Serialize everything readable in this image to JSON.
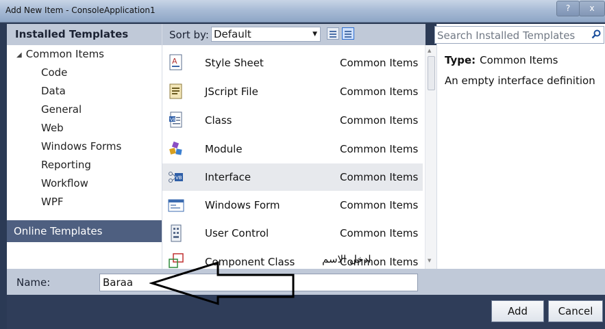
{
  "window": {
    "title": "Add New Item - ConsoleApplication1",
    "help": "?",
    "close": "x"
  },
  "left_panel": {
    "header": "Installed Templates",
    "root": "Common Items",
    "children": [
      "Code",
      "Data",
      "General",
      "Web",
      "Windows Forms",
      "Reporting",
      "Workflow",
      "WPF"
    ],
    "online": "Online Templates"
  },
  "toolbar": {
    "sort_label": "Sort by:",
    "sort_value": "Default"
  },
  "templates": [
    {
      "name": "Style Sheet",
      "category": "Common Items",
      "icon": "style-sheet-icon"
    },
    {
      "name": "JScript File",
      "category": "Common Items",
      "icon": "jscript-file-icon"
    },
    {
      "name": "Class",
      "category": "Common Items",
      "icon": "class-icon"
    },
    {
      "name": "Module",
      "category": "Common Items",
      "icon": "module-icon"
    },
    {
      "name": "Interface",
      "category": "Common Items",
      "icon": "interface-icon",
      "selected": true
    },
    {
      "name": "Windows Form",
      "category": "Common Items",
      "icon": "windows-form-icon"
    },
    {
      "name": "User Control",
      "category": "Common Items",
      "icon": "user-control-icon"
    },
    {
      "name": "Component Class",
      "category": "Common Items",
      "icon": "component-class-icon"
    }
  ],
  "details": {
    "search_placeholder": "Search Installed Templates",
    "type_label": "Type:",
    "type_value": "Common Items",
    "description": "An empty interface definition"
  },
  "name_field": {
    "label": "Name:",
    "value": "Baraa"
  },
  "buttons": {
    "add": "Add",
    "cancel": "Cancel"
  },
  "annotation": {
    "text": "ادخل الاسم"
  },
  "colors": {
    "header_bg": "#c0c9d8",
    "selected_row": "#e7e9ed",
    "online_bg": "#4e5f80",
    "frame": "#2f3d59"
  }
}
